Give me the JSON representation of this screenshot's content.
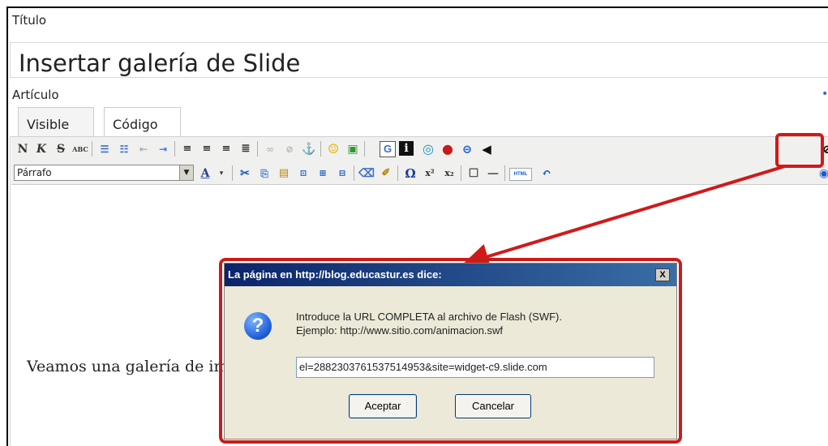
{
  "form": {
    "title_label": "Título",
    "title_value": "Insertar galería de Slide",
    "article_label": "Artículo",
    "edge_mark": "•"
  },
  "tabs": [
    {
      "label": "Visible"
    },
    {
      "label": "Código"
    }
  ],
  "toolbar": {
    "bold": "N",
    "italic": "K",
    "strike": "S",
    "spellcheck": "ABC",
    "format_select": "Párrafo",
    "text_color": "A",
    "omega": "Ω",
    "superscript": "x²",
    "subscript": "x₂",
    "google": "G",
    "info": "i",
    "html": "HTML"
  },
  "content": {
    "text": "Veamos una galería de imágenes creada en la página slide.com:"
  },
  "dialog": {
    "title": "La página en http://blog.educastur.es dice:",
    "close": "X",
    "message_line1": "Introduce la URL COMPLETA al archivo de Flash (SWF).",
    "message_line2": "Ejemplo: http://www.sitio.com/animacion.swf",
    "input_value": "el=2882303761537514953&site=widget-c9.slide.com",
    "ok_label": "Aceptar",
    "cancel_label": "Cancelar"
  },
  "colors": {
    "highlight": "#d01a1a",
    "titlebar": "#0a246a"
  }
}
